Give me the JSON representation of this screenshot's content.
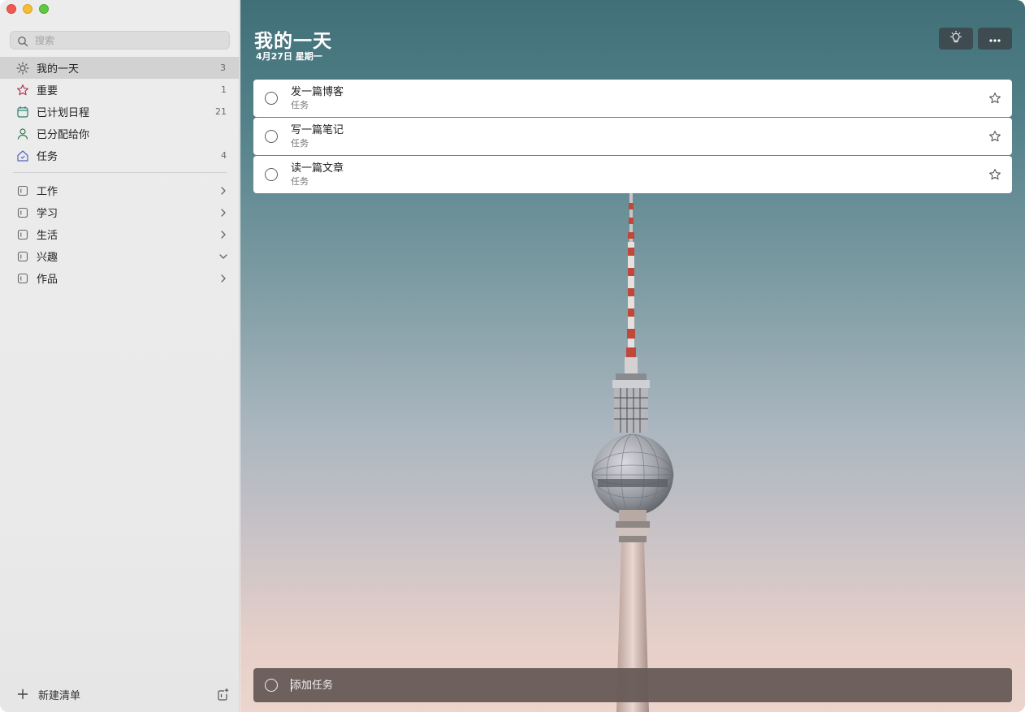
{
  "window": {
    "traffic_lights": [
      "close",
      "minimize",
      "maximize"
    ]
  },
  "sidebar": {
    "search": {
      "placeholder": "搜索",
      "value": ""
    },
    "smart_lists": [
      {
        "label": "我的一天",
        "count": "3",
        "icon": "sun-icon",
        "active": true
      },
      {
        "label": "重要",
        "count": "1",
        "icon": "star-icon",
        "color": "#b03a5b"
      },
      {
        "label": "已计划日程",
        "count": "21",
        "icon": "calendar-icon",
        "color": "#2e7d6b"
      },
      {
        "label": "已分配给你",
        "count": "",
        "icon": "person-icon",
        "color": "#2e7d4f"
      },
      {
        "label": "任务",
        "count": "4",
        "icon": "home-icon",
        "color": "#5563b8"
      }
    ],
    "groups": [
      {
        "label": "工作",
        "expanded": false
      },
      {
        "label": "学习",
        "expanded": false
      },
      {
        "label": "生活",
        "expanded": false
      },
      {
        "label": "兴趣",
        "expanded": true
      },
      {
        "label": "作品",
        "expanded": false
      }
    ],
    "new_list_label": "新建清单"
  },
  "main": {
    "title": "我的一天",
    "date": "4月27日 星期一",
    "tasks": [
      {
        "title": "发一篇博客",
        "list": "任务",
        "important": false
      },
      {
        "title": "写一篇笔记",
        "list": "任务",
        "important": false
      },
      {
        "title": "读一篇文章",
        "list": "任务",
        "important": false
      }
    ],
    "add_task": {
      "placeholder": "添加任务",
      "value": ""
    }
  },
  "colors": {
    "sidebar_bg": "#ececec",
    "active_item_bg": "#d2d2d2",
    "top_button_bg": "#3e4c51",
    "add_task_bg": "#675a56"
  }
}
